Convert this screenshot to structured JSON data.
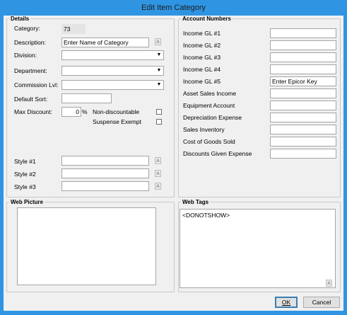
{
  "window": {
    "title": "Edit Item Category"
  },
  "details": {
    "legend": "Details",
    "category_label": "Category:",
    "category_value": "73",
    "description_label": "Description:",
    "description_value": "Enter Name of Category",
    "division_label": "Division:",
    "division_value": "",
    "department_label": "Department:",
    "department_value": "",
    "commission_label": "Commission Lvl:",
    "commission_value": "",
    "default_sort_label": "Default Sort:",
    "default_sort_value": "",
    "max_discount_label": "Max Discount:",
    "max_discount_value": "0",
    "max_discount_unit": "%",
    "non_discountable_label": "Non-discountable",
    "suspense_exempt_label": "Suspense Exempt",
    "style1_label": "Style #1",
    "style2_label": "Style #2",
    "style3_label": "Style #3"
  },
  "accounts": {
    "legend": "Account Numbers",
    "rows": [
      {
        "label": "Income GL #1",
        "value": ""
      },
      {
        "label": "Income GL #2",
        "value": ""
      },
      {
        "label": "Income GL #3",
        "value": ""
      },
      {
        "label": "Income GL #4",
        "value": ""
      },
      {
        "label": "Income GL #5",
        "value": "Enter Epicor Key"
      },
      {
        "label": "Asset Sales Income",
        "value": ""
      },
      {
        "label": "Equipment Account",
        "value": ""
      },
      {
        "label": "Depreciation Expense",
        "value": ""
      },
      {
        "label": "Sales Inventory",
        "value": ""
      },
      {
        "label": "Cost of Goods Sold",
        "value": ""
      },
      {
        "label": "Discounts Given Expense",
        "value": ""
      }
    ]
  },
  "web_picture": {
    "legend": "Web Picture"
  },
  "web_tags": {
    "legend": "Web Tags",
    "value": "<DONOTSHOW>"
  },
  "buttons": {
    "ok": "OK",
    "cancel": "Cancel"
  },
  "icons": {
    "translate": "translate-icon",
    "dropdown": "chevron-down-icon"
  }
}
